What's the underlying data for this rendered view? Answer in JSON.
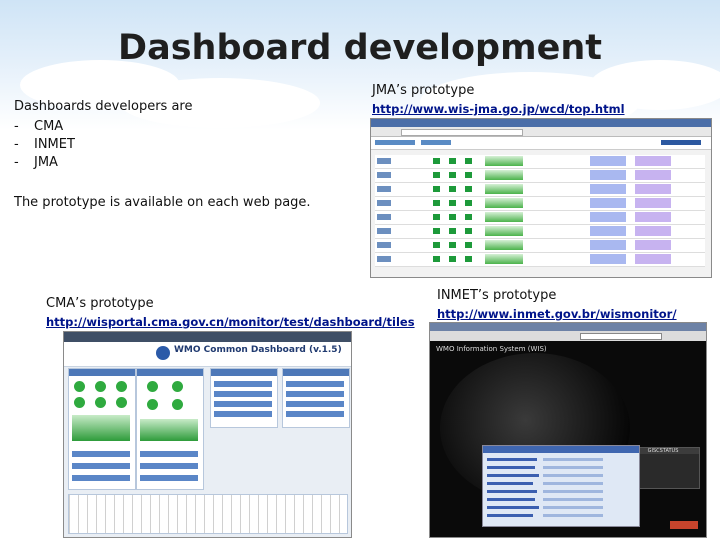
{
  "title": "Dashboard development",
  "intro": {
    "heading": "Dashboards developers are",
    "developers": [
      "CMA",
      "INMET",
      "JMA"
    ]
  },
  "note": "The prototype is available on each web page.",
  "jma": {
    "label": "JMA’s prototype",
    "url": "http://www.wis-jma.go.jp/wcd/top.html"
  },
  "cma": {
    "label": "CMA’s prototype",
    "url": "http://wisportal.cma.gov.cn/monitor/test/dashboard/tiles",
    "screenshot_title": "WMO Common Dashboard (v.1.5)"
  },
  "inmet": {
    "label": "INMET’s prototype",
    "url": "http://www.inmet.gov.br/wismonitor/",
    "screenshot_title": "WMO Information System (WIS)",
    "status_title": "GISCSTATUS"
  }
}
